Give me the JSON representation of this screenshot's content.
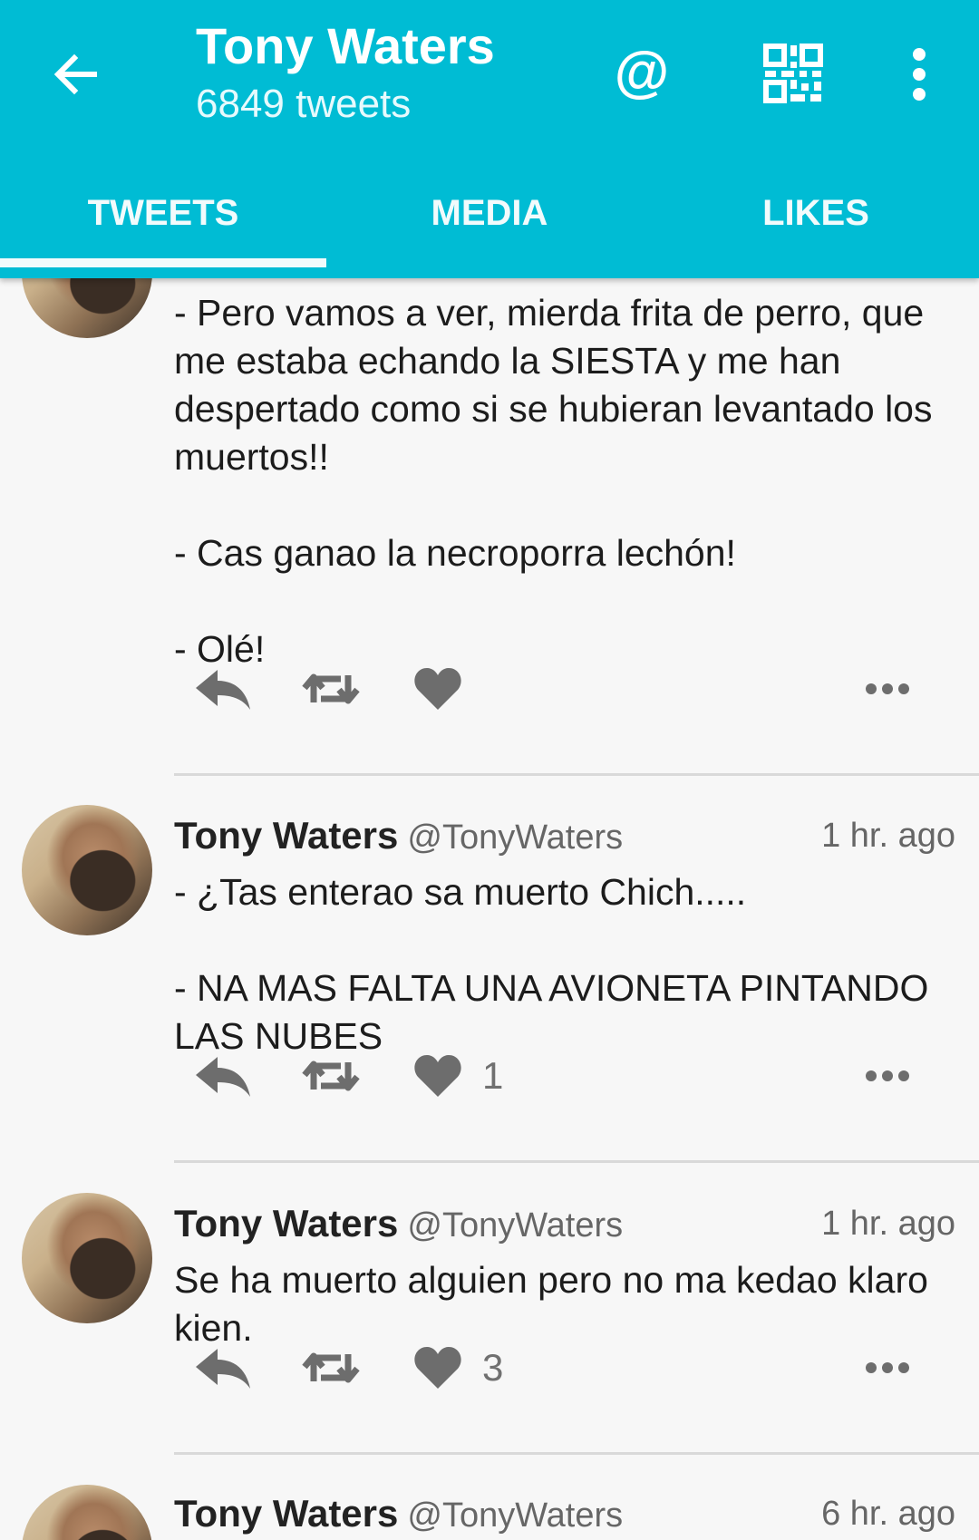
{
  "header": {
    "name": "Tony Waters",
    "tweet_count": "6849 tweets",
    "at_symbol": "@"
  },
  "tabs": [
    {
      "label": "TWEETS",
      "active": true
    },
    {
      "label": "MEDIA",
      "active": false
    },
    {
      "label": "LIKES",
      "active": false
    }
  ],
  "colors": {
    "accent": "#00bcd4",
    "icon_gray": "#6d6d6d",
    "text": "#1c1c1c",
    "meta": "#666666"
  },
  "icons": {
    "back": "arrow-left-icon",
    "mention": "at-icon",
    "qr": "qr-code-icon",
    "more": "vertical-dots-icon",
    "reply": "reply-icon",
    "retweet": "retweet-icon",
    "like": "heart-icon",
    "overflow": "horizontal-dots-icon"
  },
  "tweets": [
    {
      "author": "",
      "handle": "",
      "time": "",
      "text": "- Pero vamos a ver, mierda frita de perro, que me estaba echando la SIESTA y me han despertado como si se hubieran levantado los muertos!!\n\n- Cas ganao la necroporra lechón!\n\n- Olé!",
      "likes": ""
    },
    {
      "author": "Tony Waters",
      "handle": "@TonyWaters",
      "time": "1 hr. ago",
      "text": "- ¿Tas enterao sa muerto Chich.....\n\n- NA MAS FALTA UNA AVIONETA PINTANDO LAS NUBES",
      "likes": "1"
    },
    {
      "author": "Tony Waters",
      "handle": "@TonyWaters",
      "time": "1 hr. ago",
      "text": "Se ha muerto alguien pero no ma kedao klaro kien.",
      "likes": "3"
    },
    {
      "author": "Tony Waters",
      "handle": "@TonyWaters",
      "time": "6 hr. ago",
      "text": "",
      "likes": ""
    }
  ]
}
